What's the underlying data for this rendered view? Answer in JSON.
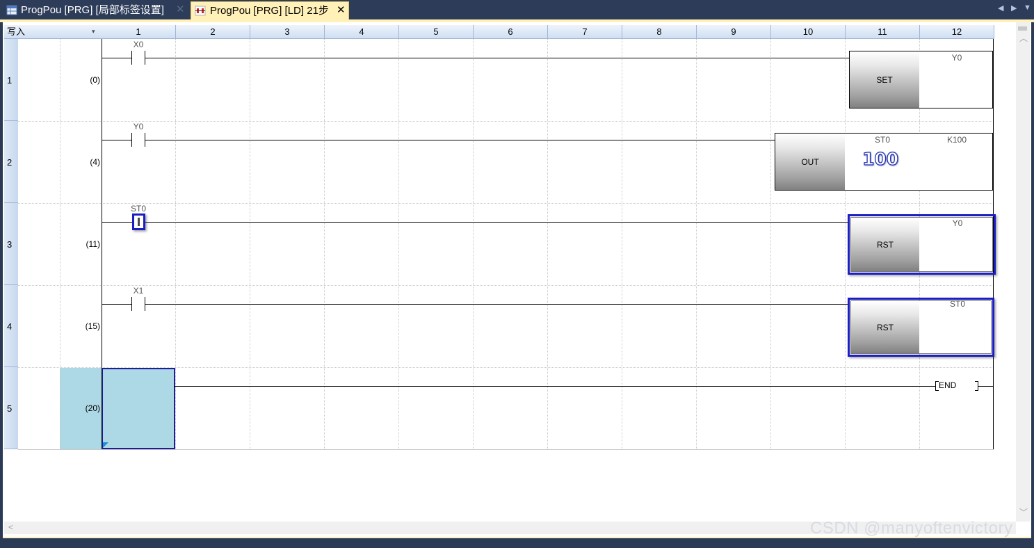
{
  "tabs": [
    {
      "label": "ProgPou [PRG] [局部标签设置]",
      "active": false
    },
    {
      "label": "ProgPou [PRG] [LD] 21步",
      "active": true
    }
  ],
  "close_glyph": "✕",
  "nav": {
    "left": "◀",
    "right": "▶"
  },
  "grid": {
    "mode": "写入",
    "mode_dropdown": "▾",
    "columns": [
      "1",
      "2",
      "3",
      "4",
      "5",
      "6",
      "7",
      "8",
      "9",
      "10",
      "11",
      "12"
    ],
    "rows": [
      {
        "num": "1",
        "step": "(0)"
      },
      {
        "num": "2",
        "step": "(4)"
      },
      {
        "num": "3",
        "step": "(11)"
      },
      {
        "num": "4",
        "step": "(15)"
      },
      {
        "num": "5",
        "step": "(20)"
      }
    ]
  },
  "rungs": {
    "r1": {
      "contact": "X0",
      "instruction": "SET",
      "operand": "Y0"
    },
    "r2": {
      "contact": "Y0",
      "instruction": "OUT",
      "operand1": "ST0",
      "operand2": "K100",
      "monitor_value": "100"
    },
    "r3": {
      "contact": "ST0",
      "instruction": "RST",
      "operand": "Y0"
    },
    "r4": {
      "contact": "X1",
      "instruction": "RST",
      "operand": "ST0"
    },
    "r5": {
      "end": "END"
    }
  },
  "watermark": "CSDN @manyoftenvictory",
  "colors": {
    "accent": "#1d1dc4",
    "cursor": "#add8e6",
    "tab_active": "#fff1b8",
    "chrome": "#2d3c59"
  }
}
